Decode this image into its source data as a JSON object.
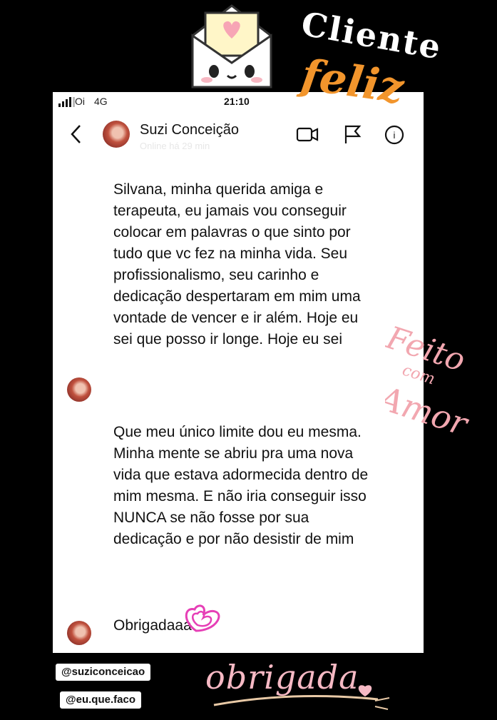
{
  "stickers": {
    "cliente": "Cliente",
    "feliz": "feliz",
    "feito": "Feito",
    "com": "com",
    "amor": "Amor",
    "obrigada": "obrigada",
    "handles": [
      "@suziconceicao",
      "@eu.que.faco"
    ]
  },
  "status_bar": {
    "carrier": "Oi",
    "network": "4G",
    "time": "21:10"
  },
  "chat": {
    "contact_name": "Suzi Conceição",
    "contact_status": "Online há 29 min",
    "messages": [
      "Silvana, minha querida amiga e terapeuta,  eu jamais vou conseguir colocar em palavras o que sinto por tudo que vc fez na minha vida. Seu profissionalismo, seu carinho e dedicação despertaram em mim uma vontade de vencer e ir além. Hoje eu sei que posso ir longe. Hoje  eu sei",
      "Que meu único limite dou eu mesma.  Minha mente se abriu pra uma nova vida que estava adormecida dentro de mim mesma. E não iria conseguir isso  NUNCA se não fosse por sua dedicação e por não desistir de mim",
      "Obrigadaaa"
    ]
  },
  "icons": [
    "envelope-sticker-icon",
    "signal-icon",
    "back-chevron-icon",
    "video-call-icon",
    "flag-icon",
    "info-icon",
    "hearts-doodle-icon"
  ],
  "colors": {
    "background": "#000000",
    "card": "#ffffff",
    "feliz": "#f2952c",
    "pink": "#f6b9c4"
  }
}
